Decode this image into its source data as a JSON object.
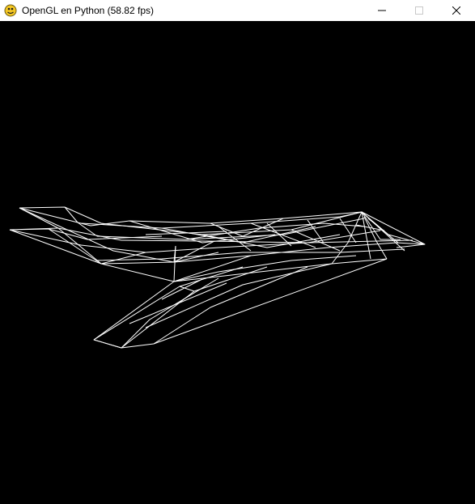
{
  "window": {
    "title": "OpenGL en Python (58.82 fps)",
    "app_icon": "pygame-snake-icon",
    "controls": [
      "minimize-icon",
      "maximize-icon",
      "close-icon"
    ]
  },
  "viewport": {
    "background": "#000000",
    "wireframe_color": "#ffffff",
    "model": "stealth-aircraft-wireframe"
  }
}
